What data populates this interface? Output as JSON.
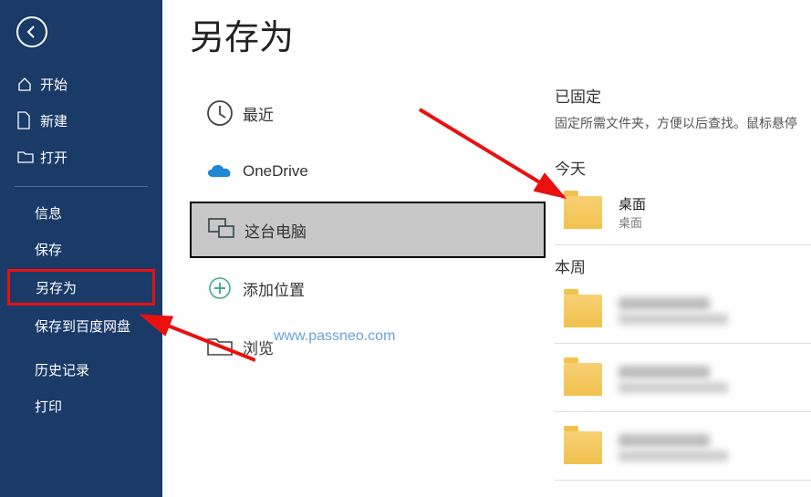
{
  "page_title": "另存为",
  "sidebar": {
    "items": [
      {
        "label": "开始"
      },
      {
        "label": "新建"
      },
      {
        "label": "打开"
      },
      {
        "label": "信息"
      },
      {
        "label": "保存"
      },
      {
        "label": "另存为"
      },
      {
        "label": "保存到百度网盘"
      },
      {
        "label": "历史记录"
      },
      {
        "label": "打印"
      }
    ]
  },
  "locations": {
    "recent": "最近",
    "onedrive": "OneDrive",
    "this_pc": "这台电脑",
    "add_place": "添加位置",
    "browse": "浏览"
  },
  "right": {
    "pinned_title": "已固定",
    "pinned_desc": "固定所需文件夹，方便以后查找。鼠标悬停",
    "today": "今天",
    "desktop_name": "桌面",
    "desktop_path": "桌面",
    "this_week": "本周"
  },
  "watermark": "www.passneo.com"
}
